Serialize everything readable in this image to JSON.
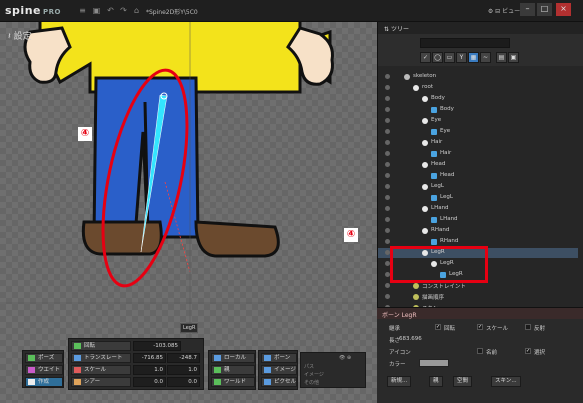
{
  "app": {
    "logo": "spine",
    "logo_suffix": "PRO",
    "title": "*Spine2D形Y\\5C0",
    "view_label": "ビュー"
  },
  "viewport": {
    "mode_label": "設定",
    "annotation": "④",
    "bone_tag": "LegR"
  },
  "toolbar": {
    "pose": "ポーズ",
    "weights": "ウエイト",
    "create": "作成",
    "rotate": "回転",
    "translate": "トランスレート",
    "scale": "スケール",
    "shear": "シアー",
    "rotate_value": "-103.085",
    "translate_x": "-716.85",
    "translate_y": "-248.7",
    "scale_x": "1.0",
    "scale_y": "1.0",
    "shear_x": "0.0",
    "shear_y": "0.0",
    "local": "ローカル",
    "parent": "親",
    "world": "ワールド",
    "bones": "ボーン",
    "images": "イメージ",
    "pick": "ピクセル",
    "paths_label": "パス",
    "images_label": "イメージ",
    "other_label": "その他"
  },
  "tree": {
    "title": "ツリー",
    "rows": [
      {
        "label": "skeleton",
        "indent": 0,
        "type": "skeleton"
      },
      {
        "label": "root",
        "indent": 1,
        "type": "bone"
      },
      {
        "label": "Body",
        "indent": 2,
        "type": "bone"
      },
      {
        "label": "Body",
        "indent": 3,
        "type": "image"
      },
      {
        "label": "Eye",
        "indent": 2,
        "type": "bone"
      },
      {
        "label": "Eye",
        "indent": 3,
        "type": "image"
      },
      {
        "label": "Hair",
        "indent": 2,
        "type": "bone"
      },
      {
        "label": "Hair",
        "indent": 3,
        "type": "image"
      },
      {
        "label": "Head",
        "indent": 2,
        "type": "bone"
      },
      {
        "label": "Head",
        "indent": 3,
        "type": "image"
      },
      {
        "label": "LegL",
        "indent": 2,
        "type": "bone"
      },
      {
        "label": "LegL",
        "indent": 3,
        "type": "image"
      },
      {
        "label": "LHand",
        "indent": 2,
        "type": "bone"
      },
      {
        "label": "LHand",
        "indent": 3,
        "type": "image"
      },
      {
        "label": "RHand",
        "indent": 2,
        "type": "bone"
      },
      {
        "label": "RHand",
        "indent": 3,
        "type": "image"
      },
      {
        "label": "LegR",
        "indent": 2,
        "type": "bone",
        "selected": true
      },
      {
        "label": "LegR",
        "indent": 3,
        "type": "bone"
      },
      {
        "label": "LegR",
        "indent": 4,
        "type": "image"
      },
      {
        "label": "コンストレイント",
        "indent": 1,
        "type": "folder"
      },
      {
        "label": "描画順序",
        "indent": 1,
        "type": "folder"
      },
      {
        "label": "スキン",
        "indent": 1,
        "type": "folder"
      }
    ]
  },
  "props": {
    "title": "ボーン LegR",
    "inherit_label": "継承",
    "rotation_cb": "回転",
    "scale_cb": "スケール",
    "reflect_cb": "反射",
    "length_label": "長さ",
    "length_value": "683.696",
    "icon_label": "アイコン",
    "name_cb": "名前",
    "select_cb": "選択",
    "color_label": "カラー",
    "new_btn": "新規...",
    "set_btn": "親",
    "empty_btn": "空間",
    "skin_btn": "スキン..."
  },
  "colors": {
    "accent": "#3a7bbf",
    "highlight_red": "#e60012",
    "bone_cyan": "#33e5ff"
  }
}
